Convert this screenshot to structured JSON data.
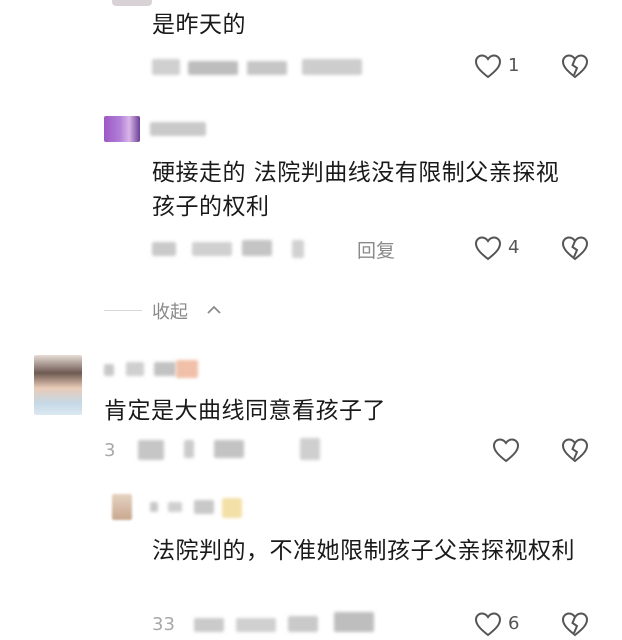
{
  "comments": [
    {
      "text": "是昨天的",
      "meta": "1小时前 · 北京 回复",
      "likes": "1"
    },
    {
      "text": "硬接走的 法院判曲线没有限制父亲探视孩子的权利",
      "meta": "回复",
      "likes": "4"
    },
    {
      "text": "肯定是大曲线同意看孩子了",
      "meta": "3",
      "likes": ""
    },
    {
      "text": "法院判的，不准她限制孩子父亲探视权利",
      "meta": "33",
      "likes": "6"
    }
  ],
  "collapse_label": "收起",
  "icons": {
    "like": "heart-outline-icon",
    "dislike": "broken-heart-icon",
    "collapse": "chevron-up-icon"
  }
}
